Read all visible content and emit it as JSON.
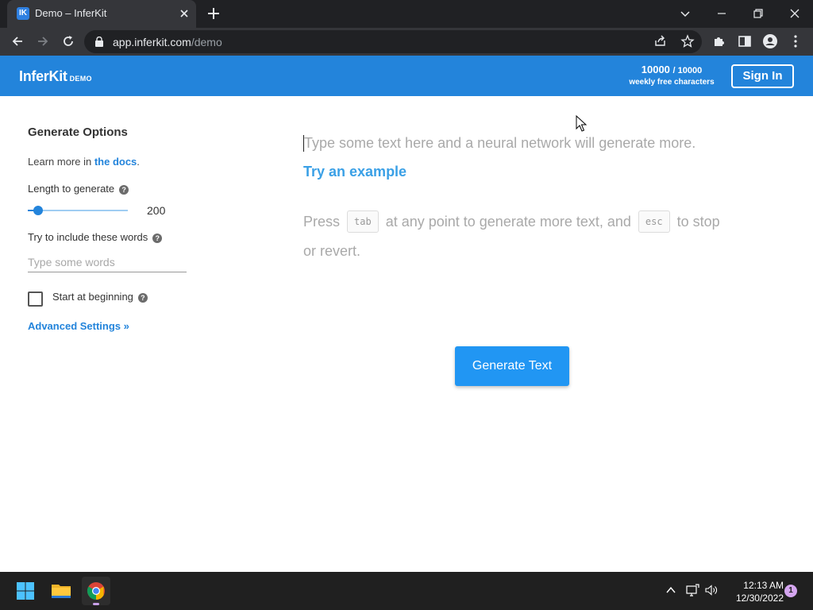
{
  "browser": {
    "tab_title": "Demo – InferKit",
    "favicon_text": "IK",
    "url_host": "app.inferkit.com",
    "url_path": "/demo"
  },
  "header": {
    "logo": "InferKit",
    "logo_badge": "DEMO",
    "quota_used": "10000",
    "quota_total": "/ 10000",
    "quota_label": "weekly free characters",
    "signin_label": "Sign In"
  },
  "options": {
    "title": "Generate Options",
    "learn_prefix": "Learn more in ",
    "docs_link": "the docs",
    "learn_suffix": ".",
    "length_label": "Length to generate",
    "length_value": "200",
    "length_fraction": 0.1,
    "words_label": "Try to include these words",
    "words_placeholder": "Type some words",
    "start_label": "Start at beginning",
    "start_checked": false,
    "advanced_label": "Advanced Settings »",
    "help_glyph": "?"
  },
  "editor": {
    "placeholder": "Type some text here and a neural network will generate more.",
    "try_example": "Try an example",
    "hint_press": "Press",
    "hint_key_tab": "tab",
    "hint_middle": "at any point to generate more text, and",
    "hint_key_esc": "esc",
    "hint_end": "to stop",
    "hint_line2": "or revert.",
    "generate_label": "Generate Text"
  },
  "taskbar": {
    "time": "12:13 AM",
    "date": "12/30/2022",
    "notification_count": "1"
  },
  "colors": {
    "brand": "#2384db",
    "button": "#2196f3",
    "link": "#3aa0e6"
  }
}
